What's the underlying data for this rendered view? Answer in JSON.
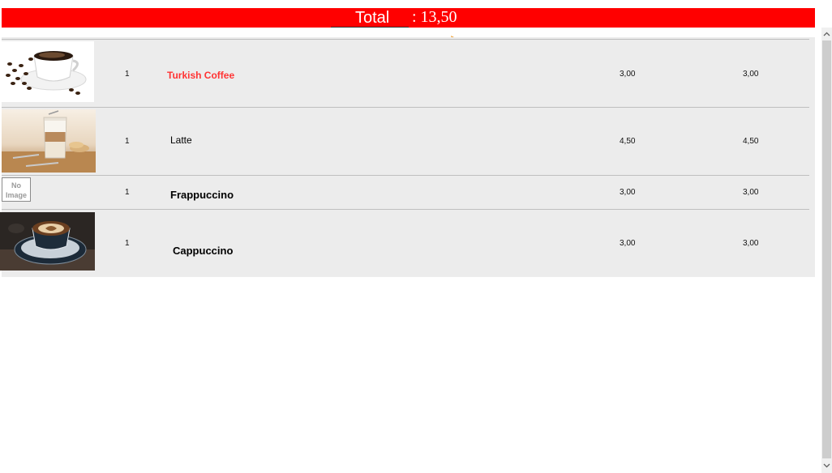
{
  "header": {
    "total_label": "Total",
    "total_value": ": 13,50"
  },
  "orders": [
    {
      "image": "turkish-coffee-cup-image",
      "quantity": "1",
      "name": "Turkish Coffee",
      "price": "3,00",
      "amount": "3,00",
      "selected": true
    },
    {
      "image": "latte-glass-image",
      "quantity": "1",
      "name": "Latte",
      "price": "4,50",
      "amount": "4,50",
      "selected": false
    },
    {
      "image_placeholder": [
        "No",
        "Image"
      ],
      "quantity": "1",
      "name": "Frappuccino",
      "price": "3,00",
      "amount": "3,00",
      "selected": false
    },
    {
      "image": "cappuccino-cup-image",
      "quantity": "1",
      "name": "Cappuccino",
      "price": "3,00",
      "amount": "3,00",
      "selected": false
    }
  ],
  "colors": {
    "total_bar": "#ff0000",
    "selected_text": "#ff3333",
    "list_background": "#ececec",
    "annotation_arrow": "#f0a030"
  },
  "icons": {
    "annotation": "curved-arrow-icon",
    "scroll_up": "chevron-up-icon",
    "scroll_down": "chevron-down-icon"
  }
}
